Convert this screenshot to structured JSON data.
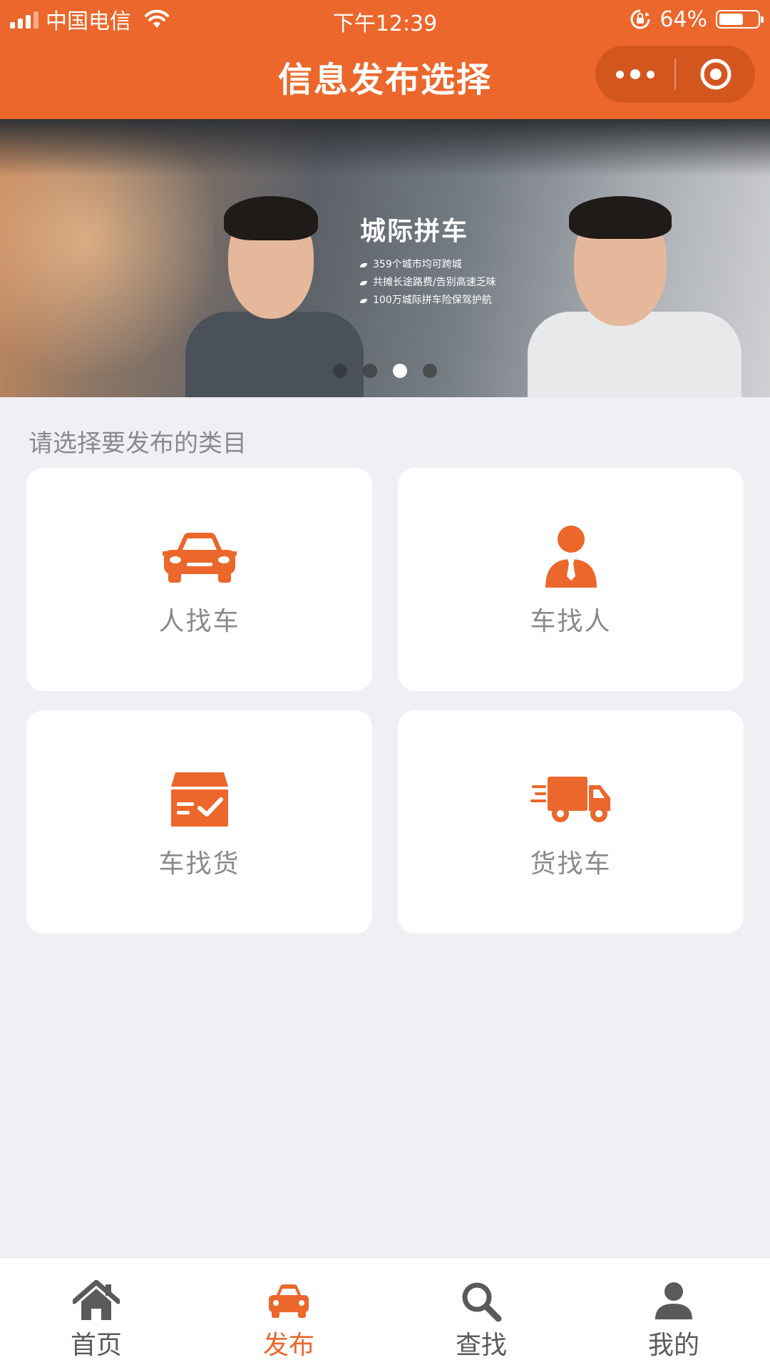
{
  "status_bar": {
    "carrier": "中国电信",
    "time": "下午12:39",
    "battery_percent": "64%",
    "battery_level": 0.64
  },
  "nav": {
    "title": "信息发布选择",
    "more_icon": "more-dots-icon",
    "close_icon": "target-close-icon"
  },
  "banner": {
    "title": "城际拼车",
    "lines": [
      "359个城市均可跨城",
      "共摊长途路费/告别高速乏味",
      "100万城际拼车险保驾护航"
    ],
    "slide_count": 4,
    "active_slide": 3
  },
  "section_label": "请选择要发布的类目",
  "categories": [
    {
      "label": "人找车",
      "icon": "car-icon"
    },
    {
      "label": "车找人",
      "icon": "person-icon"
    },
    {
      "label": "车找货",
      "icon": "cargo-box-icon"
    },
    {
      "label": "货找车",
      "icon": "truck-icon"
    }
  ],
  "tabs": [
    {
      "label": "首页",
      "icon": "home-icon",
      "active": false
    },
    {
      "label": "发布",
      "icon": "car-icon",
      "active": true
    },
    {
      "label": "查找",
      "icon": "search-icon",
      "active": false
    },
    {
      "label": "我的",
      "icon": "user-icon",
      "active": false
    }
  ],
  "colors": {
    "accent": "#ec672b",
    "background": "#efeff4",
    "text_gray": "#8a8a8e",
    "tab_inactive": "#5a5a5a"
  }
}
